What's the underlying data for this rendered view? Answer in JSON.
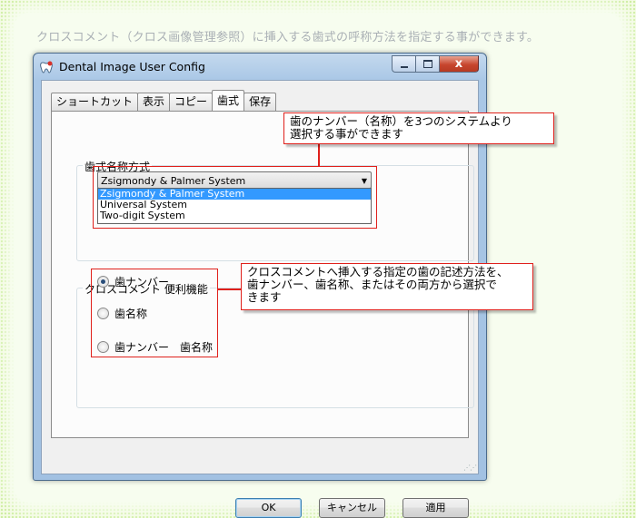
{
  "caption": "クロスコメント（クロス画像管理参照）に挿入する歯式の呼称方法を指定する事ができます。",
  "window": {
    "title": "Dental Image User Config",
    "minimize_glyph": "▭",
    "maximize_glyph": "□",
    "close_glyph": "x"
  },
  "tabs": [
    "ショートカット",
    "表示",
    "コピー",
    "歯式",
    "保存"
  ],
  "naming_group": {
    "label": "歯式名称方式",
    "combo_value": "Zsigmondy & Palmer System",
    "options": [
      "Zsigmondy & Palmer System",
      "Universal System",
      "Two-digit System"
    ],
    "selected_index": 0
  },
  "cross_group": {
    "label": "クロスコメント 便利機能",
    "options": [
      "歯ナンバー",
      "歯名称",
      "歯ナンバー　歯名称"
    ],
    "checked_index": 0
  },
  "buttons": {
    "ok": "OK",
    "cancel": "キャンセル",
    "apply": "適用"
  },
  "callouts": {
    "top": [
      "歯のナンバー（名称）を3つのシステムより",
      "選択する事ができます"
    ],
    "right": [
      "クロスコメントへ挿入する指定の歯の記述方法を、",
      "歯ナンバー、歯名称、またはその両方から選択で",
      "きます"
    ]
  },
  "colors": {
    "annotation_red": "#e0201b",
    "selection_blue": "#3399ff"
  }
}
